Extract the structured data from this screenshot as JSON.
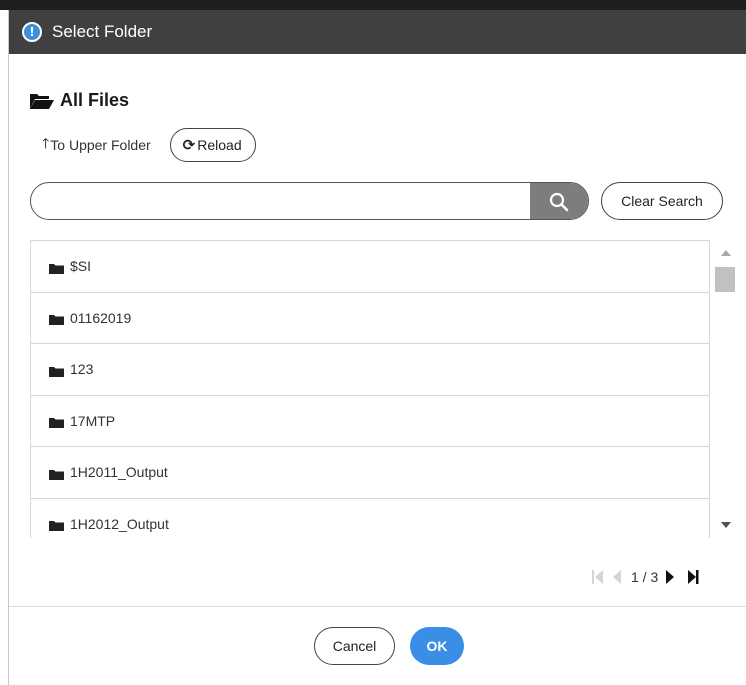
{
  "dialog": {
    "title": "Select Folder",
    "title_icon": "info-icon"
  },
  "browser": {
    "current_folder": "All Files",
    "upper_folder_label": "To Upper Folder",
    "reload_label": "Reload"
  },
  "search": {
    "value": "",
    "placeholder": "",
    "clear_label": "Clear Search"
  },
  "folders": [
    {
      "name": "$SI",
      "icon": "folder-icon"
    },
    {
      "name": "01162019",
      "icon": "folder-icon"
    },
    {
      "name": "123",
      "icon": "folder-icon"
    },
    {
      "name": "17MTP",
      "icon": "folder-icon"
    },
    {
      "name": "1H2011_Output",
      "icon": "folder-icon"
    },
    {
      "name": "1H2012_Output",
      "icon": "folder-icon"
    }
  ],
  "pagination": {
    "page_text": "1 / 3"
  },
  "actions": {
    "cancel_label": "Cancel",
    "ok_label": "OK"
  },
  "colors": {
    "titlebar": "#404040",
    "accent": "#3a8ee6",
    "search_button": "#7d7d7d"
  }
}
